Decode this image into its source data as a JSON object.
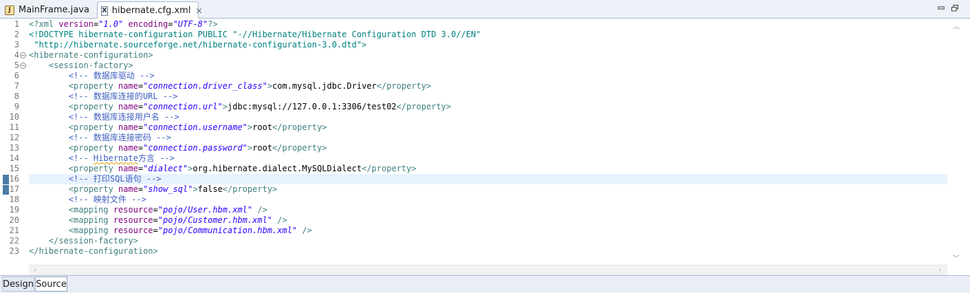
{
  "tabs": [
    {
      "label": "MainFrame.java",
      "icon": "java-file-icon",
      "active": false
    },
    {
      "label": "hibernate.cfg.xml",
      "icon": "xml-file-icon",
      "active": true,
      "closable": true
    }
  ],
  "window_controls": {
    "minimize": "minimize-icon",
    "restore": "restore-icon"
  },
  "editor": {
    "current_line": 16,
    "lines": [
      {
        "n": "1",
        "segs": [
          [
            "c-tag",
            "<?xml "
          ],
          [
            "c-attr",
            "version"
          ],
          [
            "c-text",
            "="
          ],
          [
            "c-val",
            "\"1.0\""
          ],
          [
            "c-text",
            " "
          ],
          [
            "c-attr",
            "encoding"
          ],
          [
            "c-text",
            "="
          ],
          [
            "c-val",
            "\"UTF-8\""
          ],
          [
            "c-tag",
            "?>"
          ]
        ]
      },
      {
        "n": "2",
        "segs": [
          [
            "c-decl",
            "<!DOCTYPE hibernate-configuration "
          ],
          [
            "c-decl",
            "PUBLIC "
          ],
          [
            "c-dq",
            "\"-//Hibernate/Hibernate Configuration DTD 3.0//EN\""
          ]
        ]
      },
      {
        "n": "3",
        "segs": [
          [
            "c-dq",
            " \"http://hibernate.sourceforge.net/hibernate-configuration-3.0.dtd\">"
          ]
        ]
      },
      {
        "n": "4",
        "fold": true,
        "segs": [
          [
            "c-tag",
            "<hibernate-configuration>"
          ]
        ]
      },
      {
        "n": "5",
        "fold": true,
        "segs": [
          [
            "c-text",
            "    "
          ],
          [
            "c-tag",
            "<session-factory>"
          ]
        ]
      },
      {
        "n": "6",
        "segs": [
          [
            "c-text",
            "        "
          ],
          [
            "c-comment",
            "<!-- "
          ],
          [
            "c-comment cn",
            "数据库驱动"
          ],
          [
            "c-comment",
            " -->"
          ]
        ]
      },
      {
        "n": "7",
        "segs": [
          [
            "c-text",
            "        "
          ],
          [
            "c-tag",
            "<property "
          ],
          [
            "c-attr",
            "name"
          ],
          [
            "c-text",
            "="
          ],
          [
            "c-val",
            "\"connection.driver_class\""
          ],
          [
            "c-tag",
            ">"
          ],
          [
            "c-text",
            "com.mysql.jdbc.Driver"
          ],
          [
            "c-tag",
            "</property>"
          ]
        ]
      },
      {
        "n": "8",
        "segs": [
          [
            "c-text",
            "        "
          ],
          [
            "c-comment",
            "<!-- "
          ],
          [
            "c-comment cn",
            "数据库连接的"
          ],
          [
            "c-comment",
            "URL -->"
          ]
        ]
      },
      {
        "n": "9",
        "segs": [
          [
            "c-text",
            "        "
          ],
          [
            "c-tag",
            "<property "
          ],
          [
            "c-attr",
            "name"
          ],
          [
            "c-text",
            "="
          ],
          [
            "c-val",
            "\"connection.url\""
          ],
          [
            "c-tag",
            ">"
          ],
          [
            "c-text",
            "jdbc:mysql://127.0.0.1:3306/test02"
          ],
          [
            "c-tag",
            "</property>"
          ]
        ]
      },
      {
        "n": "10",
        "segs": [
          [
            "c-text",
            "        "
          ],
          [
            "c-comment",
            "<!-- "
          ],
          [
            "c-comment cn",
            "数据库连接用户名"
          ],
          [
            "c-comment",
            " -->"
          ]
        ]
      },
      {
        "n": "11",
        "segs": [
          [
            "c-text",
            "        "
          ],
          [
            "c-tag",
            "<property "
          ],
          [
            "c-attr",
            "name"
          ],
          [
            "c-text",
            "="
          ],
          [
            "c-val",
            "\"connection.username\""
          ],
          [
            "c-tag",
            ">"
          ],
          [
            "c-text",
            "root"
          ],
          [
            "c-tag",
            "</property>"
          ]
        ]
      },
      {
        "n": "12",
        "segs": [
          [
            "c-text",
            "        "
          ],
          [
            "c-comment",
            "<!-- "
          ],
          [
            "c-comment cn",
            "数据库连接密码"
          ],
          [
            "c-comment",
            " -->"
          ]
        ]
      },
      {
        "n": "13",
        "segs": [
          [
            "c-text",
            "        "
          ],
          [
            "c-tag",
            "<property "
          ],
          [
            "c-attr",
            "name"
          ],
          [
            "c-text",
            "="
          ],
          [
            "c-val",
            "\"connection.password\""
          ],
          [
            "c-tag",
            ">"
          ],
          [
            "c-text",
            "root"
          ],
          [
            "c-tag",
            "</property>"
          ]
        ]
      },
      {
        "n": "14",
        "segs": [
          [
            "c-text",
            "        "
          ],
          [
            "c-comment",
            "<!-- "
          ],
          [
            "c-comment squig",
            "Hibernate"
          ],
          [
            "c-comment cn",
            "方言"
          ],
          [
            "c-comment",
            " -->"
          ]
        ]
      },
      {
        "n": "15",
        "segs": [
          [
            "c-text",
            "        "
          ],
          [
            "c-tag",
            "<property "
          ],
          [
            "c-attr",
            "name"
          ],
          [
            "c-text",
            "="
          ],
          [
            "c-val",
            "\"dialect\""
          ],
          [
            "c-tag",
            ">"
          ],
          [
            "c-text",
            "org.hibernate.dialect.MySQLDialect"
          ],
          [
            "c-tag",
            "</property>"
          ]
        ]
      },
      {
        "n": "16",
        "mark": true,
        "segs": [
          [
            "c-text",
            "        "
          ],
          [
            "c-comment",
            "<!-- "
          ],
          [
            "c-comment cn",
            "打印"
          ],
          [
            "c-comment",
            "SQL"
          ],
          [
            "c-comment cn",
            "语句"
          ],
          [
            "c-comment",
            " -->"
          ]
        ]
      },
      {
        "n": "17",
        "mark": true,
        "segs": [
          [
            "c-text",
            "        "
          ],
          [
            "c-tag",
            "<property "
          ],
          [
            "c-attr",
            "name"
          ],
          [
            "c-text",
            "="
          ],
          [
            "c-val",
            "\"show_sql\""
          ],
          [
            "c-tag",
            ">"
          ],
          [
            "c-text",
            "false"
          ],
          [
            "c-tag",
            "</property>"
          ]
        ]
      },
      {
        "n": "18",
        "segs": [
          [
            "c-text",
            "        "
          ],
          [
            "c-comment",
            "<!-- "
          ],
          [
            "c-comment cn",
            "映射文件"
          ],
          [
            "c-comment",
            " -->"
          ]
        ]
      },
      {
        "n": "19",
        "segs": [
          [
            "c-text",
            "        "
          ],
          [
            "c-tag",
            "<mapping "
          ],
          [
            "c-attr",
            "resource"
          ],
          [
            "c-text",
            "="
          ],
          [
            "c-val",
            "\"pojo/User.hbm.xml\""
          ],
          [
            "c-tag",
            " />"
          ]
        ]
      },
      {
        "n": "20",
        "segs": [
          [
            "c-text",
            "        "
          ],
          [
            "c-tag",
            "<mapping "
          ],
          [
            "c-attr",
            "resource"
          ],
          [
            "c-text",
            "="
          ],
          [
            "c-val",
            "\"pojo/Customer.hbm.xml\""
          ],
          [
            "c-tag",
            " />"
          ]
        ]
      },
      {
        "n": "21",
        "segs": [
          [
            "c-text",
            "        "
          ],
          [
            "c-tag",
            "<mapping "
          ],
          [
            "c-attr",
            "resource"
          ],
          [
            "c-text",
            "="
          ],
          [
            "c-val",
            "\"pojo/Communication.hbm.xml\""
          ],
          [
            "c-tag",
            " />"
          ]
        ]
      },
      {
        "n": "22",
        "segs": [
          [
            "c-text",
            "    "
          ],
          [
            "c-tag",
            "</session-factory>"
          ]
        ]
      },
      {
        "n": "23",
        "segs": [
          [
            "c-tag",
            "</hibernate-configuration>"
          ]
        ]
      }
    ]
  },
  "bottom_tabs": [
    {
      "label": "Design",
      "active": false
    },
    {
      "label": "Source",
      "active": true
    }
  ]
}
